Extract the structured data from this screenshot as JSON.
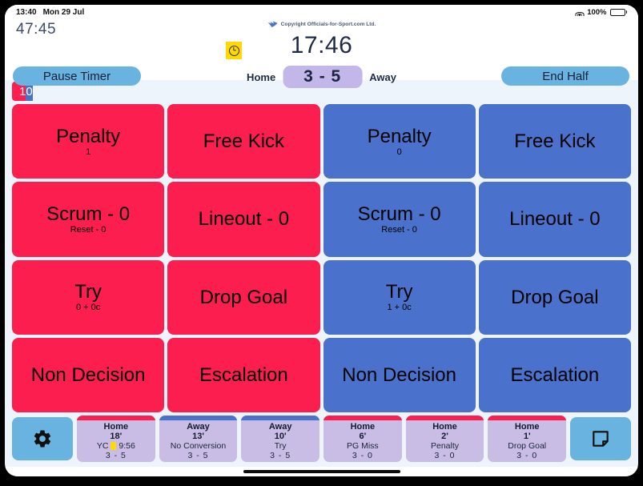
{
  "statusbar": {
    "time": "13:40",
    "date": "Mon 29 Jul",
    "battery_percent": "100%",
    "wifi_icon": "wifi-icon",
    "battery_icon": "battery-icon"
  },
  "header": {
    "elapsed_time": "47:45",
    "copyright": "Copyright Officials-for-Sport.com Ltd.",
    "logo_icon": "bird-logo-icon",
    "match_clock": "17:46",
    "clock_badge_icon": "clock-icon",
    "pause_timer_label": "Pause Timer",
    "end_half_label": "End Half",
    "home_label": "Home",
    "away_label": "Away",
    "score": "3 - 5"
  },
  "possession": {
    "home_count": "1",
    "away_count": "0",
    "home_color": "#fb1e4e",
    "away_color": "#4a72cd"
  },
  "actions": [
    {
      "main": "Penalty",
      "sub": "1",
      "team": "home"
    },
    {
      "main": "Free Kick",
      "sub": "",
      "team": "home"
    },
    {
      "main": "Penalty",
      "sub": "0",
      "team": "away"
    },
    {
      "main": "Free Kick",
      "sub": "",
      "team": "away"
    },
    {
      "main": "Scrum - 0",
      "sub": "Reset - 0",
      "team": "home"
    },
    {
      "main": "Lineout - 0",
      "sub": "",
      "team": "home"
    },
    {
      "main": "Scrum - 0",
      "sub": "Reset - 0",
      "team": "away"
    },
    {
      "main": "Lineout - 0",
      "sub": "",
      "team": "away"
    },
    {
      "main": "Try",
      "sub": "0 + 0c",
      "team": "home"
    },
    {
      "main": "Drop Goal",
      "sub": "",
      "team": "home"
    },
    {
      "main": "Try",
      "sub": "1 + 0c",
      "team": "away"
    },
    {
      "main": "Drop Goal",
      "sub": "",
      "team": "away"
    },
    {
      "main": "Non Decision",
      "sub": "",
      "team": "home"
    },
    {
      "main": "Escalation",
      "sub": "",
      "team": "home"
    },
    {
      "main": "Non Decision",
      "sub": "",
      "team": "away"
    },
    {
      "main": "Escalation",
      "sub": "",
      "team": "away"
    }
  ],
  "footer": {
    "settings_icon": "gear-icon",
    "notes_icon": "note-icon",
    "events": [
      {
        "team": "Home",
        "minute": "18'",
        "desc": "YC",
        "card": "yellow",
        "extra": "9:56",
        "score": "3 - 5",
        "side": "home"
      },
      {
        "team": "Away",
        "minute": "13'",
        "desc": "No Conversion",
        "card": "",
        "extra": "",
        "score": "3 - 5",
        "side": "away"
      },
      {
        "team": "Away",
        "minute": "10'",
        "desc": "Try",
        "card": "",
        "extra": "",
        "score": "3 - 5",
        "side": "away"
      },
      {
        "team": "Home",
        "minute": "6'",
        "desc": "PG Miss",
        "card": "",
        "extra": "",
        "score": "3 - 0",
        "side": "home"
      },
      {
        "team": "Home",
        "minute": "2'",
        "desc": "Penalty",
        "card": "",
        "extra": "",
        "score": "3 - 0",
        "side": "home"
      },
      {
        "team": "Home",
        "minute": "1'",
        "desc": "Drop Goal",
        "card": "",
        "extra": "",
        "score": "3 - 0",
        "side": "home"
      }
    ]
  }
}
